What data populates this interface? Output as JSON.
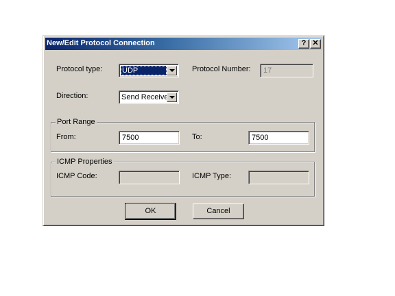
{
  "dialog": {
    "title": "New/Edit Protocol Connection",
    "help_button": "?",
    "close_button": "✕"
  },
  "protocol": {
    "type_label": "Protocol type:",
    "type_value": "UDP",
    "number_label": "Protocol Number:",
    "number_value": "17"
  },
  "direction": {
    "label": "Direction:",
    "value": "Send Receive"
  },
  "port_range": {
    "group_title": "Port Range",
    "from_label": "From:",
    "from_value": "7500",
    "to_label": "To:",
    "to_value": "7500"
  },
  "icmp": {
    "group_title": "ICMP Properties",
    "code_label": "ICMP Code:",
    "code_value": "",
    "type_label": "ICMP Type:",
    "type_value": ""
  },
  "buttons": {
    "ok": "OK",
    "cancel": "Cancel"
  }
}
